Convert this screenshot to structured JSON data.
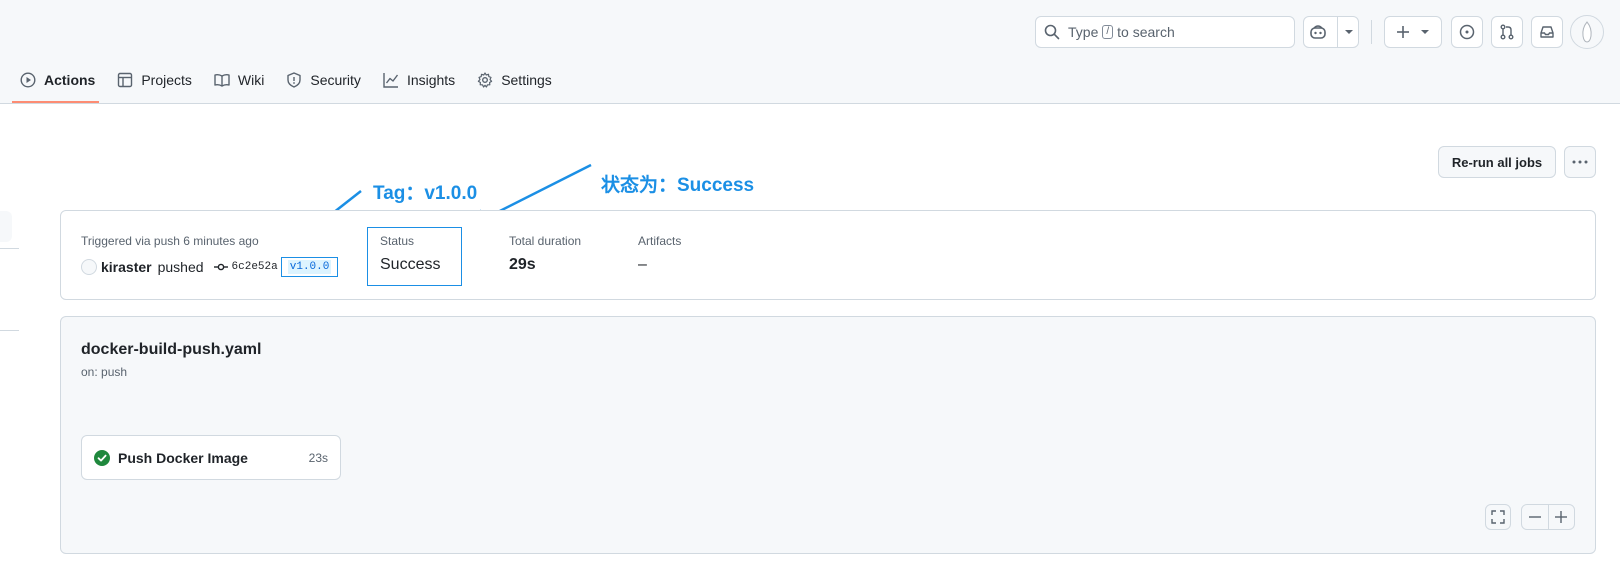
{
  "header": {
    "search": {
      "prefix": "Type",
      "key": "/",
      "suffix": "to search"
    }
  },
  "tabs": [
    {
      "label": "Actions",
      "icon": "play-icon",
      "active": true
    },
    {
      "label": "Projects",
      "icon": "table-icon"
    },
    {
      "label": "Wiki",
      "icon": "book-icon"
    },
    {
      "label": "Security",
      "icon": "shield-icon"
    },
    {
      "label": "Insights",
      "icon": "graph-icon"
    },
    {
      "label": "Settings",
      "icon": "gear-icon"
    }
  ],
  "actions": {
    "rerun_label": "Re-run all jobs"
  },
  "annotations": {
    "tag_note": "Tag：v1.0.0",
    "status_note": "状态为：Success",
    "color": "#1b8fe5"
  },
  "summary": {
    "trigger_text": "Triggered via push 6 minutes ago",
    "user": "kiraster",
    "action": "pushed",
    "commit": "6c2e52a",
    "tag": "v1.0.0",
    "status_label": "Status",
    "status_value": "Success",
    "duration_label": "Total duration",
    "duration_value": "29s",
    "artifacts_label": "Artifacts",
    "artifacts_value": "–"
  },
  "workflow": {
    "name": "docker-build-push.yaml",
    "trigger": "on: push",
    "jobs": [
      {
        "name": "Push Docker Image",
        "duration": "23s",
        "status": "success"
      }
    ]
  },
  "colors": {
    "accent_underline": "#fd8c73",
    "success": "#1f883d",
    "link": "#0969da"
  }
}
